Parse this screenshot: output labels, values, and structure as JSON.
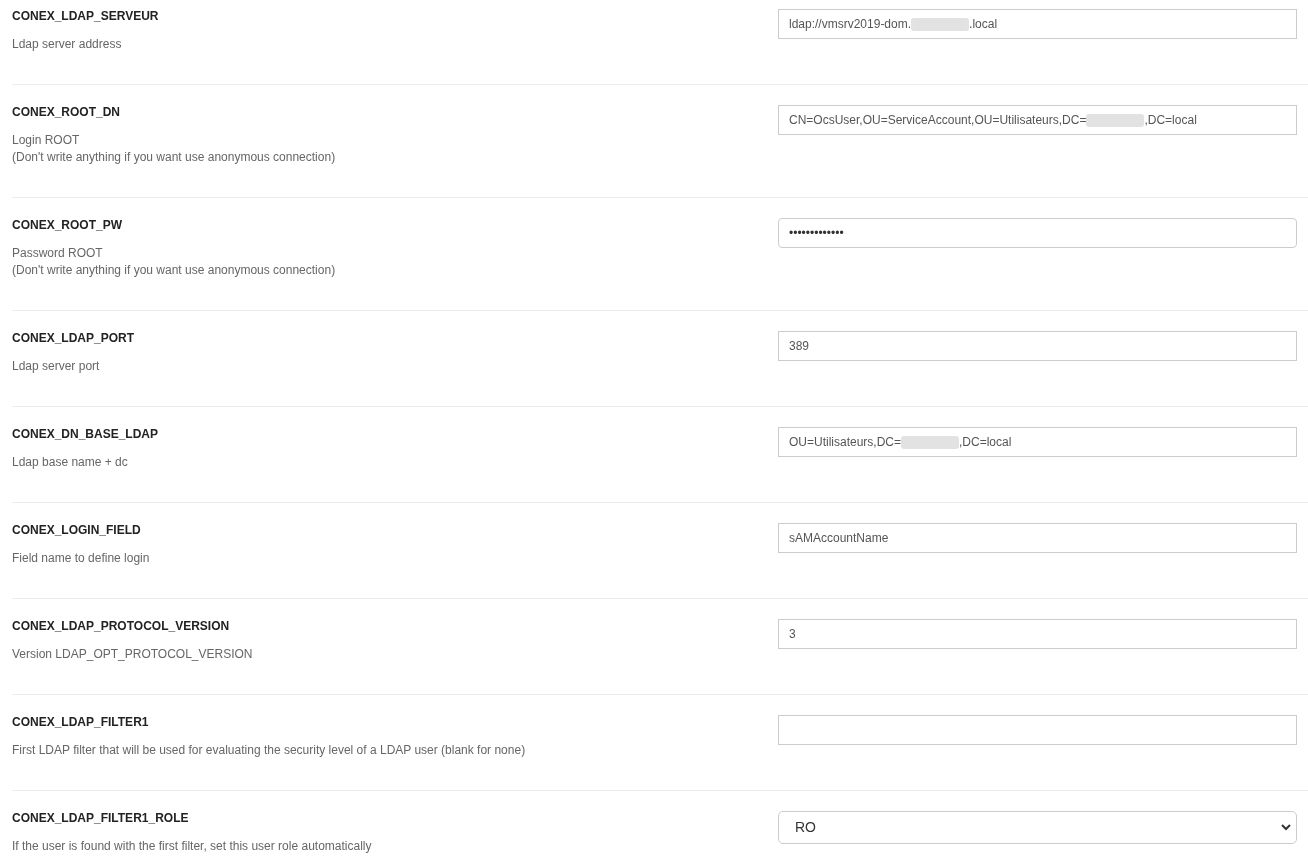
{
  "settings": [
    {
      "name": "CONEX_LDAP_SERVEUR",
      "description": [
        "Ldap server address"
      ],
      "field": {
        "kind": "text",
        "value_parts": [
          {
            "kind": "text",
            "text": "ldap://vmsrv2019-dom."
          },
          {
            "kind": "redacted"
          },
          {
            "kind": "text",
            "text": ".local"
          }
        ]
      }
    },
    {
      "name": "CONEX_ROOT_DN",
      "description": [
        "Login ROOT",
        "(Don't write anything if you want use anonymous connection)"
      ],
      "field": {
        "kind": "text",
        "value_parts": [
          {
            "kind": "text",
            "text": "CN=OcsUser,OU=ServiceAccount,OU=Utilisateurs,DC="
          },
          {
            "kind": "redacted"
          },
          {
            "kind": "text",
            "text": ",DC=local"
          }
        ]
      }
    },
    {
      "name": "CONEX_ROOT_PW",
      "description": [
        "Password ROOT",
        "(Don't write anything if you want use anonymous connection)"
      ],
      "field": {
        "kind": "password",
        "value": "•••••••••••••"
      }
    },
    {
      "name": "CONEX_LDAP_PORT",
      "description": [
        "Ldap server port"
      ],
      "field": {
        "kind": "text",
        "value": "389"
      }
    },
    {
      "name": "CONEX_DN_BASE_LDAP",
      "description": [
        "Ldap base name + dc"
      ],
      "field": {
        "kind": "text",
        "value_parts": [
          {
            "kind": "text",
            "text": "OU=Utilisateurs,DC="
          },
          {
            "kind": "redacted"
          },
          {
            "kind": "text",
            "text": ",DC=local"
          }
        ]
      }
    },
    {
      "name": "CONEX_LOGIN_FIELD",
      "description": [
        "Field name to define login"
      ],
      "field": {
        "kind": "text",
        "value": "sAMAccountName"
      }
    },
    {
      "name": "CONEX_LDAP_PROTOCOL_VERSION",
      "description": [
        "Version LDAP_OPT_PROTOCOL_VERSION"
      ],
      "field": {
        "kind": "text",
        "value": "3"
      }
    },
    {
      "name": "CONEX_LDAP_FILTER1",
      "description": [
        "First LDAP filter that will be used for evaluating the security level of a LDAP user (blank for none)"
      ],
      "field": {
        "kind": "text"
      }
    },
    {
      "name": "CONEX_LDAP_FILTER1_ROLE",
      "description": [
        "If the user is found with the first filter, set this user role automatically"
      ],
      "field": {
        "kind": "select",
        "value": "RO"
      }
    }
  ]
}
